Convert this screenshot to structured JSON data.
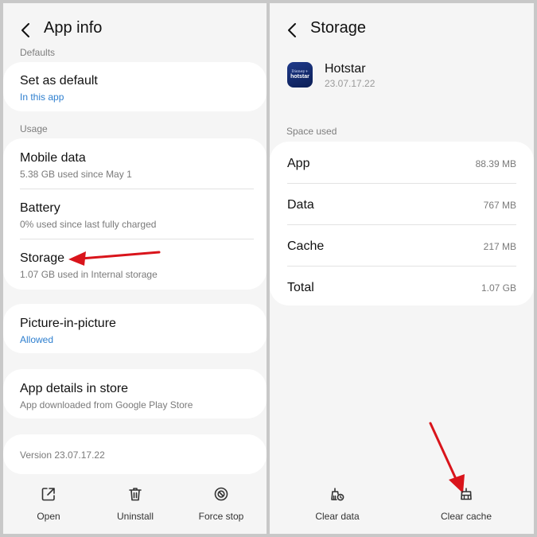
{
  "left": {
    "title": "App info",
    "section_defaults": "Defaults",
    "set_default": {
      "title": "Set as default",
      "subtitle": "In this app"
    },
    "section_usage": "Usage",
    "mobile_data": {
      "title": "Mobile data",
      "subtitle": "5.38 GB used since May 1"
    },
    "battery": {
      "title": "Battery",
      "subtitle": "0% used since last fully charged"
    },
    "storage": {
      "title": "Storage",
      "subtitle": "1.07 GB used in Internal storage"
    },
    "pip": {
      "title": "Picture-in-picture",
      "subtitle": "Allowed"
    },
    "app_details": {
      "title": "App details in store",
      "subtitle": "App downloaded from Google Play Store"
    },
    "version": "Version 23.07.17.22",
    "bottom": {
      "open": "Open",
      "uninstall": "Uninstall",
      "force_stop": "Force stop"
    }
  },
  "right": {
    "title": "Storage",
    "app_name": "Hotstar",
    "app_version": "23.07.17.22",
    "icon_text": {
      "line1": "Disney+",
      "line2": "hotstar"
    },
    "section_space": "Space used",
    "rows": [
      {
        "label": "App",
        "value": "88.39 MB"
      },
      {
        "label": "Data",
        "value": "767 MB"
      },
      {
        "label": "Cache",
        "value": "217 MB"
      },
      {
        "label": "Total",
        "value": "1.07 GB"
      }
    ],
    "bottom": {
      "clear_data": "Clear data",
      "clear_cache": "Clear cache"
    }
  },
  "icons": [
    "back-icon",
    "open-external-icon",
    "trash-icon",
    "force-stop-icon",
    "clear-data-icon",
    "clear-cache-icon",
    "red-arrow-annotation"
  ],
  "colors": {
    "accent_blue": "#2e7fcf",
    "annotation_red": "#d9141b",
    "card_bg": "#ffffff",
    "page_bg": "#f5f5f5"
  }
}
